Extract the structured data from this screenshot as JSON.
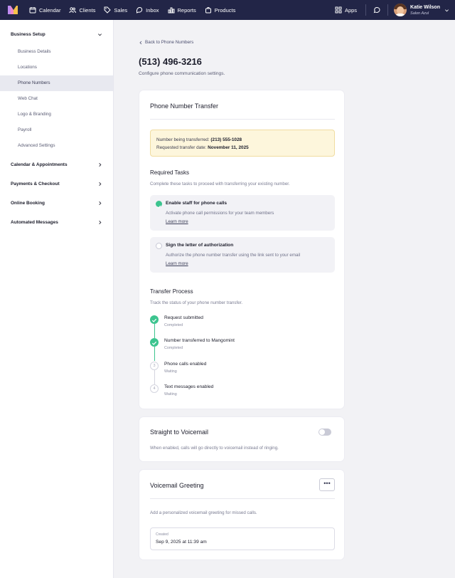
{
  "nav": {
    "items": [
      {
        "label": "Calendar",
        "icon": "calendar-icon"
      },
      {
        "label": "Clients",
        "icon": "users-icon"
      },
      {
        "label": "Sales",
        "icon": "tag-icon"
      },
      {
        "label": "Inbox",
        "icon": "inbox-icon"
      },
      {
        "label": "Reports",
        "icon": "bar-chart-icon"
      },
      {
        "label": "Products",
        "icon": "bag-icon"
      }
    ],
    "apps_label": "Apps",
    "user": {
      "name": "Katie Wilson",
      "location": "Salon Azul"
    }
  },
  "sidebar": {
    "business_setup": "Business Setup",
    "sub_items": [
      {
        "label": "Business Details"
      },
      {
        "label": "Locations"
      },
      {
        "label": "Phone Numbers",
        "active": true
      },
      {
        "label": "Web Chat"
      },
      {
        "label": "Logo & Branding"
      },
      {
        "label": "Payroll"
      },
      {
        "label": "Advanced Settings"
      }
    ],
    "sections": [
      {
        "label": "Calendar & Appointments"
      },
      {
        "label": "Payments & Checkout"
      },
      {
        "label": "Online Booking"
      },
      {
        "label": "Automated Messages"
      }
    ]
  },
  "page": {
    "back_label": "Back to Phone Numbers",
    "title": "(513) 496-3216",
    "subtitle": "Configure phone communication settings."
  },
  "transfer": {
    "title": "Phone Number Transfer",
    "notice_number_label": "Number being transferred:",
    "notice_number_value": "(213) 555-1028",
    "notice_date_label": "Requested transfer date:",
    "notice_date_value": "November 11, 2025",
    "tasks_title": "Required Tasks",
    "tasks_desc": "Complete these tasks to proceed with transferring your existing number.",
    "tasks": [
      {
        "title": "Enable staff for phone calls",
        "desc": "Activate phone call permissions for your team members",
        "link": "Learn more",
        "done": true
      },
      {
        "title": "Sign the letter of authorization",
        "desc": "Authorize the phone number transfer using the link sent to your email",
        "link": "Learn more",
        "done": false
      }
    ],
    "process_title": "Transfer Process",
    "process_desc": "Track the status of your phone number transfer.",
    "steps": [
      {
        "label": "Request submitted",
        "status": "Completed",
        "marker": ""
      },
      {
        "label": "Number transferred to Mangomint",
        "status": "Completed",
        "marker": ""
      },
      {
        "label": "Phone calls enabled",
        "status": "Waiting",
        "marker": "3"
      },
      {
        "label": "Text messages enabled",
        "status": "Waiting",
        "marker": "4"
      }
    ]
  },
  "voicemail": {
    "title": "Straight to Voicemail",
    "desc": "When enabled, calls will go directly to voicemail instead of ringing.",
    "enabled": false
  },
  "greeting": {
    "title": "Voicemail Greeting",
    "more_label": "•••",
    "desc": "Add a personalized voicemail greeting for missed calls.",
    "created_label": "Created",
    "created_value": "Sep 9, 2025 at 11:39 am"
  },
  "colors": {
    "nav_bg": "#222547",
    "success": "#3cc48f",
    "notice_bg": "#fdf6dc"
  }
}
